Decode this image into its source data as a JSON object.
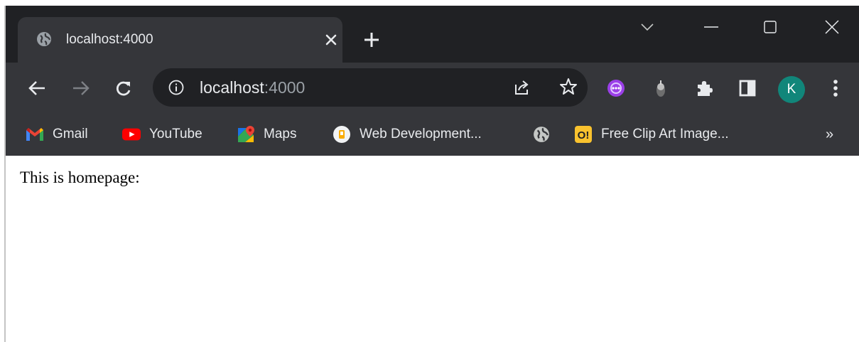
{
  "tab": {
    "title": "localhost:4000"
  },
  "omnibox": {
    "host": "localhost",
    "port": ":4000"
  },
  "profile": {
    "initial": "K"
  },
  "bookmarks": [
    {
      "label": "Gmail",
      "icon": "gmail-icon"
    },
    {
      "label": "YouTube",
      "icon": "youtube-icon"
    },
    {
      "label": "Maps",
      "icon": "maps-icon"
    },
    {
      "label": "Web Development...",
      "icon": "web-dev-icon"
    },
    {
      "label": "",
      "icon": "globe-icon"
    },
    {
      "label": "Free Clip Art Image...",
      "icon": "clipart-icon"
    }
  ],
  "bookmarks_more": "»",
  "page": {
    "text": "This is homepage:"
  },
  "colors": {
    "frame": "#202124",
    "toolbar": "#35363a",
    "avatar": "#11867a"
  }
}
